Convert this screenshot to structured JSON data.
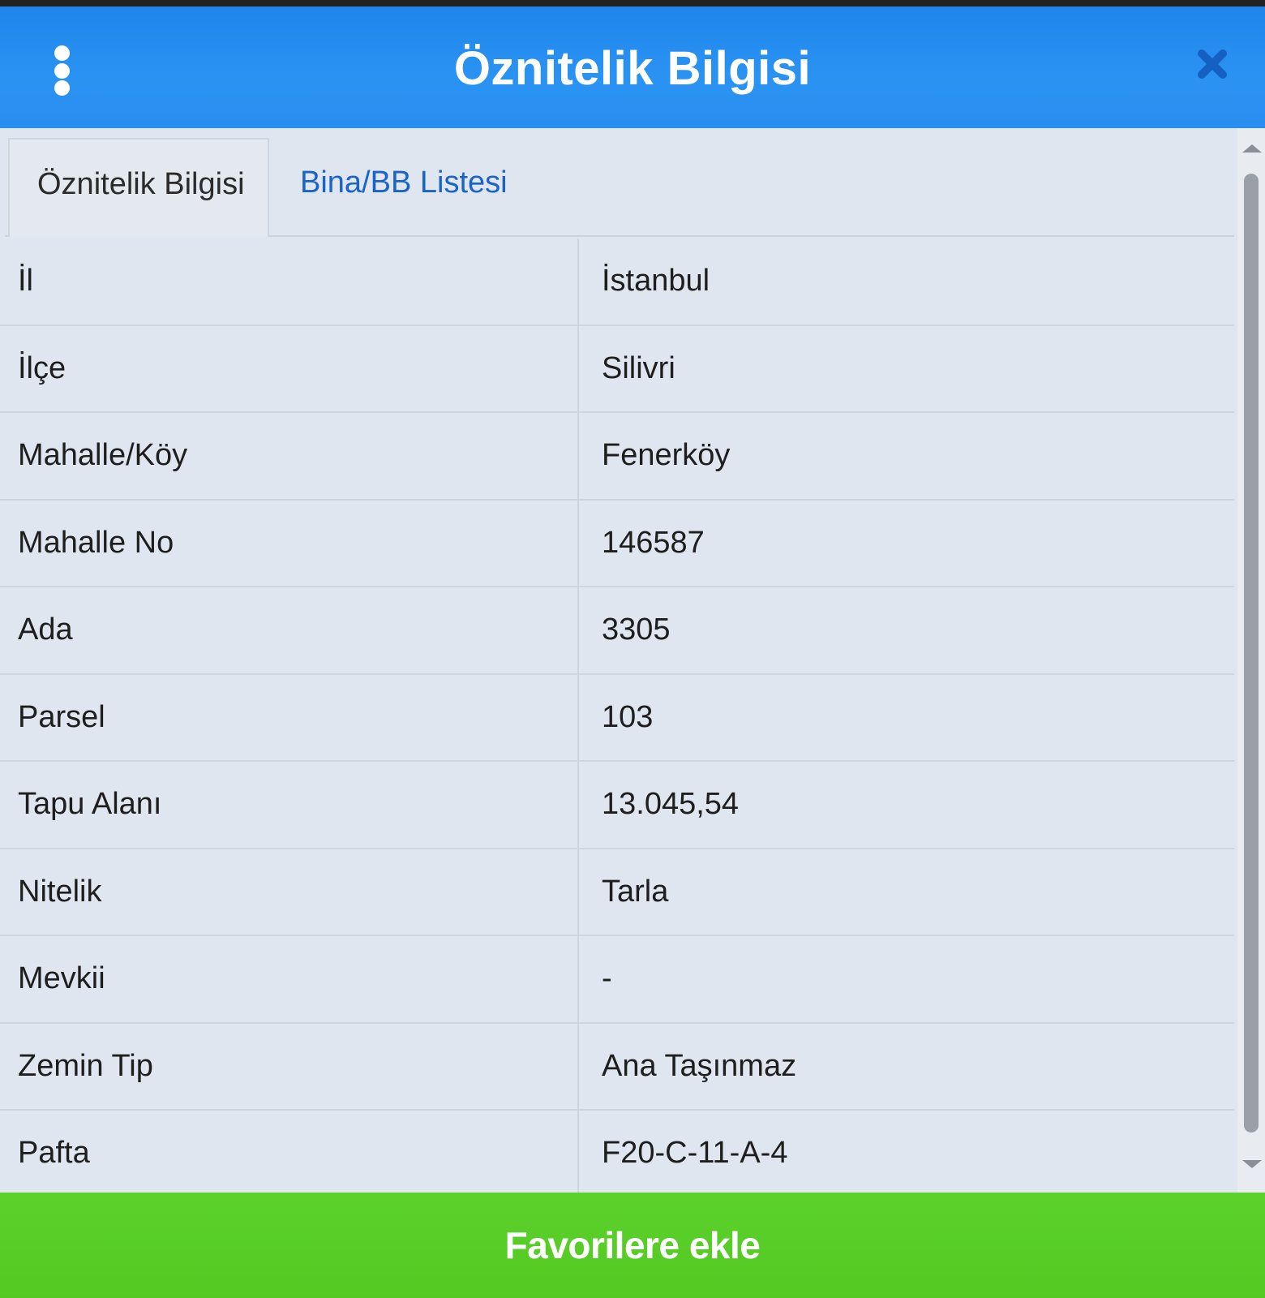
{
  "header": {
    "title": "Öznitelik Bilgisi",
    "accent_color": "#2a8ef0",
    "menu_icon": "more-vertical-icon",
    "close_icon": "close-icon"
  },
  "tabs": [
    {
      "label": "Öznitelik Bilgisi",
      "active": true
    },
    {
      "label": "Bina/BB Listesi",
      "active": false
    }
  ],
  "attributes": [
    {
      "key": "İl",
      "value": "İstanbul"
    },
    {
      "key": "İlçe",
      "value": "Silivri"
    },
    {
      "key": "Mahalle/Köy",
      "value": "Fenerköy"
    },
    {
      "key": "Mahalle No",
      "value": "146587"
    },
    {
      "key": "Ada",
      "value": "3305"
    },
    {
      "key": "Parsel",
      "value": "103"
    },
    {
      "key": "Tapu Alanı",
      "value": "13.045,54"
    },
    {
      "key": "Nitelik",
      "value": "Tarla"
    },
    {
      "key": "Mevkii",
      "value": "-"
    },
    {
      "key": "Zemin Tip",
      "value": "Ana Taşınmaz"
    },
    {
      "key": "Pafta",
      "value": "F20-C-11-A-4"
    }
  ],
  "footer": {
    "button_label": "Favorilere ekle",
    "button_color": "#56cb24"
  }
}
